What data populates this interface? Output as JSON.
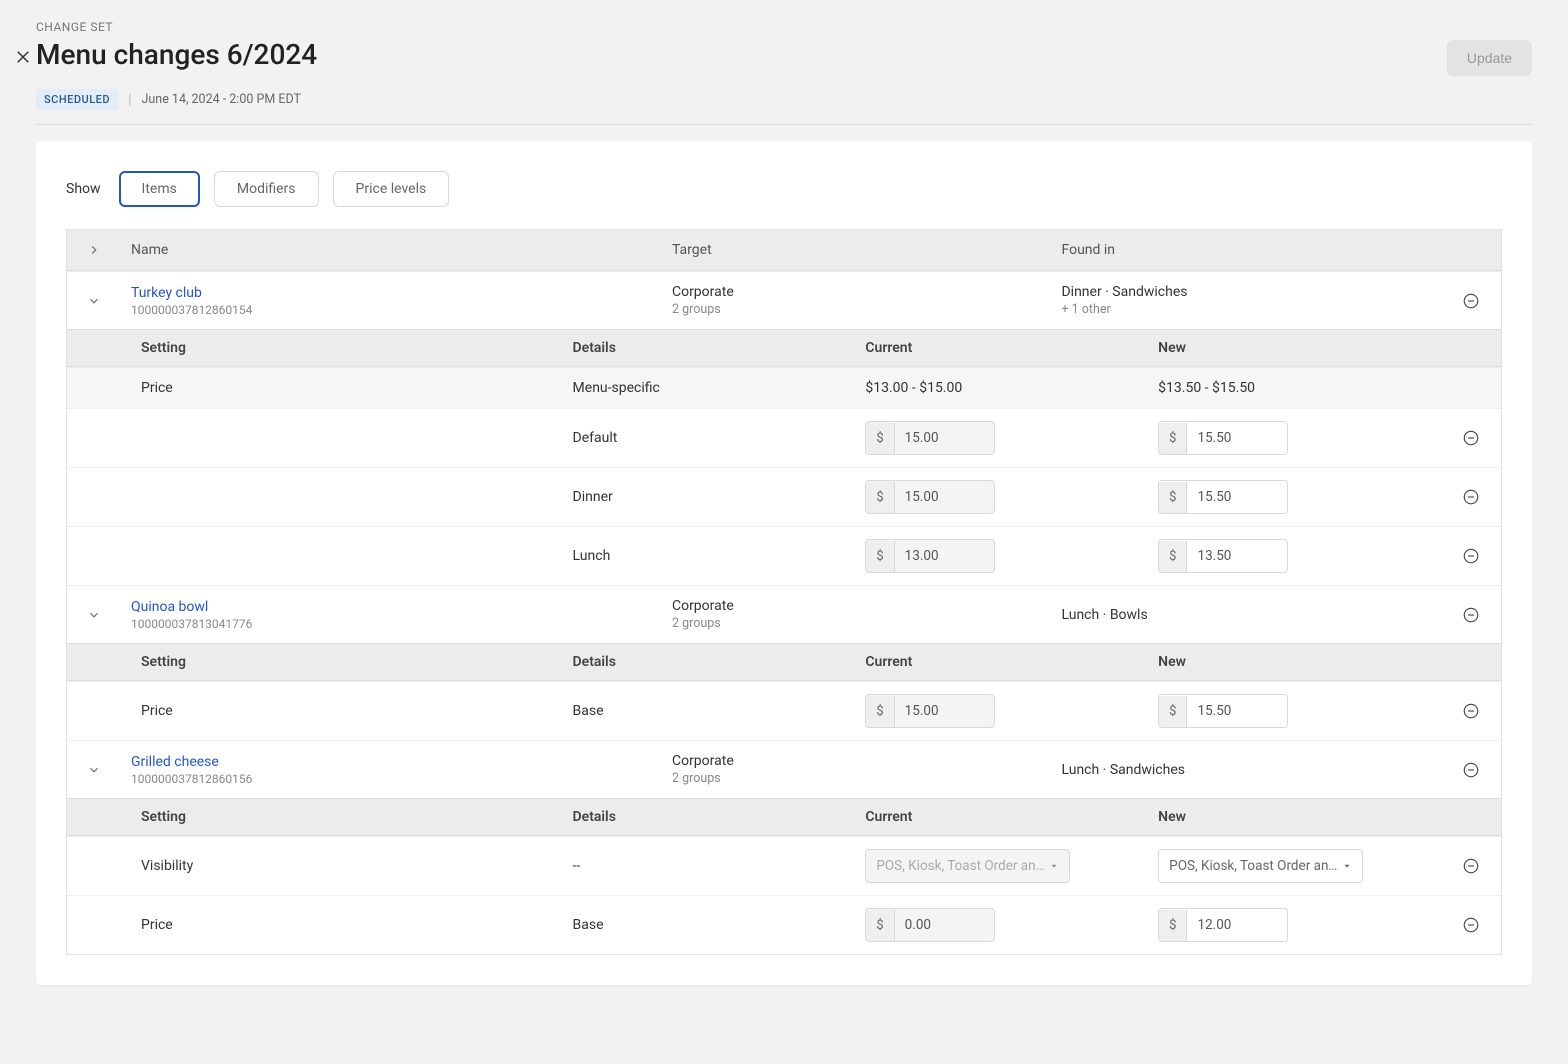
{
  "header": {
    "kicker": "CHANGE SET",
    "title": "Menu changes 6/2024",
    "badge": "SCHEDULED",
    "date": "June 14, 2024 - 2:00 PM EDT",
    "update_label": "Update"
  },
  "tabs": {
    "show_label": "Show",
    "items": "Items",
    "modifiers": "Modifiers",
    "price_levels": "Price levels"
  },
  "columns": {
    "name": "Name",
    "target": "Target",
    "found_in": "Found in"
  },
  "sub_columns": {
    "setting": "Setting",
    "details": "Details",
    "current": "Current",
    "new": "New"
  },
  "items": [
    {
      "name": "Turkey club",
      "id": "100000037812860154",
      "target": "Corporate",
      "target_sub": "2 groups",
      "found_in": "Dinner · Sandwiches",
      "found_sub": "+ 1 other",
      "summary": {
        "setting": "Price",
        "details": "Menu-specific",
        "current": "$13.00 - $15.00",
        "new": "$13.50 - $15.50"
      },
      "rows": [
        {
          "details": "Default",
          "current": "15.00",
          "new": "15.50"
        },
        {
          "details": "Dinner",
          "current": "15.00",
          "new": "15.50"
        },
        {
          "details": "Lunch",
          "current": "13.00",
          "new": "13.50"
        }
      ]
    },
    {
      "name": "Quinoa bowl",
      "id": "100000037813041776",
      "target": "Corporate",
      "target_sub": "2 groups",
      "found_in": "Lunch · Bowls",
      "rows_price": [
        {
          "setting": "Price",
          "details": "Base",
          "current": "15.00",
          "new": "15.50"
        }
      ]
    },
    {
      "name": "Grilled cheese",
      "id": "100000037812860156",
      "target": "Corporate",
      "target_sub": "2 groups",
      "found_in": "Lunch · Sandwiches",
      "rows_vis": [
        {
          "setting": "Visibility",
          "details": "--",
          "current": "POS, Kiosk, Toast Order an…",
          "new": "POS, Kiosk, Toast Order an…"
        }
      ],
      "rows_price": [
        {
          "setting": "Price",
          "details": "Base",
          "current": "0.00",
          "new": "12.00"
        }
      ]
    }
  ],
  "currency": "$"
}
